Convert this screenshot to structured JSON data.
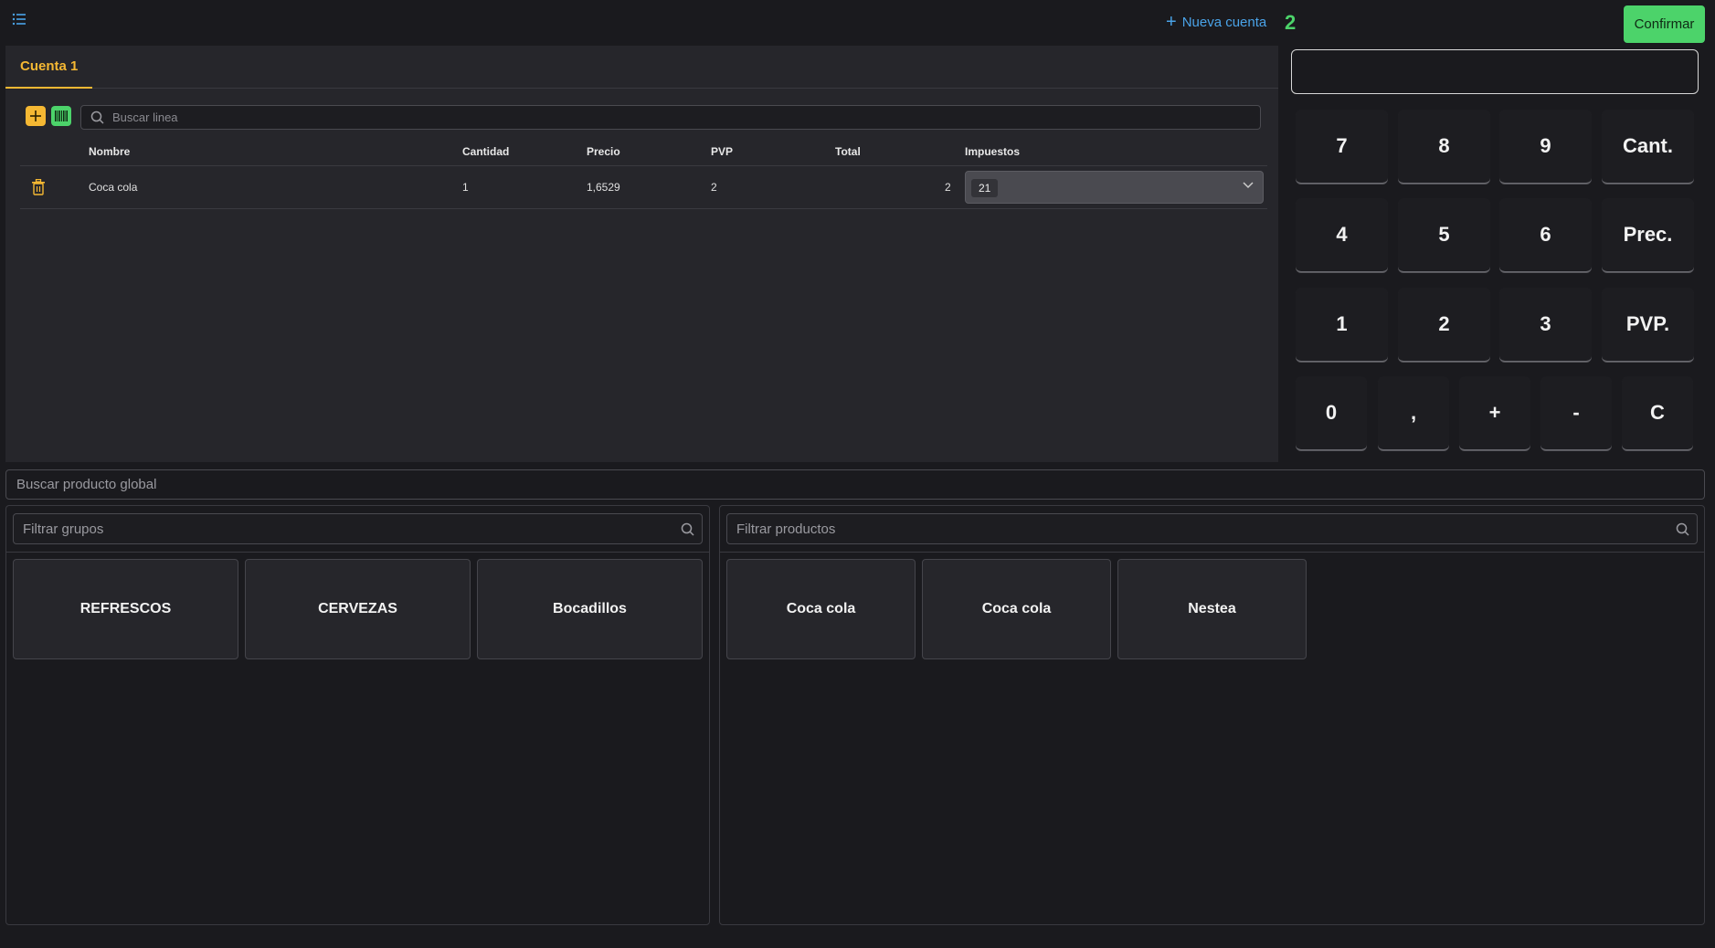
{
  "header": {
    "new_account_label": "Nueva cuenta",
    "account_count": "2",
    "confirm_label": "Confirmar"
  },
  "tabs": [
    {
      "label": "Cuenta 1"
    }
  ],
  "line_search": {
    "placeholder": "Buscar linea"
  },
  "table": {
    "columns": [
      "Nombre",
      "Cantidad",
      "Precio",
      "PVP",
      "Total",
      "Impuestos"
    ],
    "rows": [
      {
        "nombre": "Coca cola",
        "cantidad": "1",
        "precio": "1,6529",
        "pvp": "2",
        "total": "2",
        "impuestos": "21"
      }
    ]
  },
  "keypad": {
    "rows": [
      [
        "7",
        "8",
        "9",
        "Cant."
      ],
      [
        "4",
        "5",
        "6",
        "Prec."
      ],
      [
        "1",
        "2",
        "3",
        "PVP."
      ],
      [
        "0",
        ",",
        "+",
        "-",
        "C"
      ]
    ]
  },
  "global_search": {
    "placeholder": "Buscar producto global"
  },
  "groups": {
    "filter_placeholder": "Filtrar grupos",
    "items": [
      "REFRESCOS",
      "CERVEZAS",
      "Bocadillos"
    ]
  },
  "products": {
    "filter_placeholder": "Filtrar productos",
    "items": [
      "Coca cola",
      "Coca cola",
      "Nestea"
    ]
  },
  "colors": {
    "accent_yellow": "#f5b833",
    "accent_green": "#4cd36a",
    "link_blue": "#4aa3e8"
  }
}
